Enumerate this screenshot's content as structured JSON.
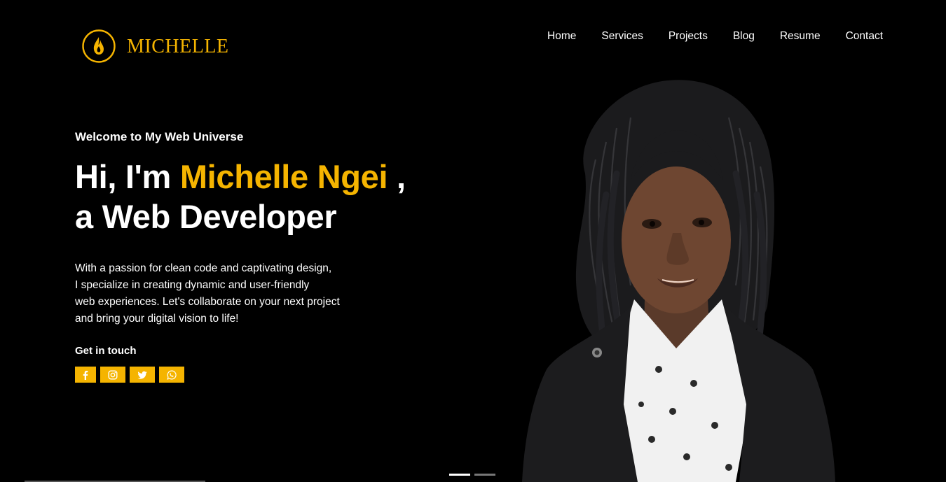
{
  "brand": {
    "name": "MICHELLE",
    "logo_icon": "flame-icon",
    "accent_color": "#f5b400"
  },
  "nav": {
    "items": [
      {
        "label": "Home"
      },
      {
        "label": "Services"
      },
      {
        "label": "Projects"
      },
      {
        "label": "Blog"
      },
      {
        "label": "Resume"
      },
      {
        "label": "Contact"
      }
    ]
  },
  "hero": {
    "eyebrow": "Welcome to My Web Universe",
    "greeting": "Hi, I'm ",
    "name": "Michelle Ngei",
    "comma": " ,",
    "role_line": "a Web Developer",
    "intro_lines": [
      "With a passion for clean code and captivating design,",
      "I specialize in creating dynamic and user-friendly",
      "web experiences. Let's collaborate on your next project",
      "and bring your digital vision to life!"
    ],
    "get_in_touch": "Get in touch",
    "socials": [
      {
        "icon": "facebook-icon"
      },
      {
        "icon": "instagram-icon"
      },
      {
        "icon": "twitter-icon"
      },
      {
        "icon": "whatsapp-icon"
      }
    ]
  },
  "slider": {
    "slides": 2,
    "active": 1
  }
}
